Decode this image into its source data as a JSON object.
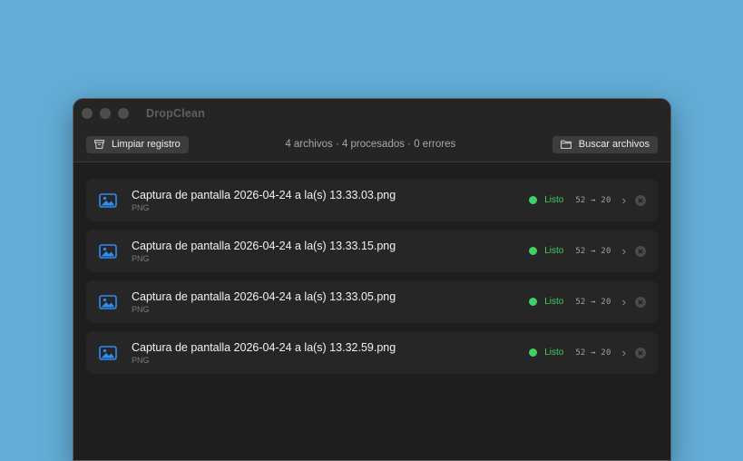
{
  "window": {
    "title": "DropClean"
  },
  "toolbar": {
    "clear_label": "Limpiar registro",
    "summary": "4 archivos · 4 procesados · 0 errores",
    "browse_label": "Buscar archivos"
  },
  "files": [
    {
      "name": "Captura de pantalla 2026-04-24 a la(s) 13.33.03.png",
      "type": "PNG",
      "status": "Listo",
      "size": "52 → 20"
    },
    {
      "name": "Captura de pantalla 2026-04-24 a la(s) 13.33.15.png",
      "type": "PNG",
      "status": "Listo",
      "size": "52 → 20"
    },
    {
      "name": "Captura de pantalla 2026-04-24 a la(s) 13.33.05.png",
      "type": "PNG",
      "status": "Listo",
      "size": "52 → 20"
    },
    {
      "name": "Captura de pantalla 2026-04-24 a la(s) 13.32.59.png",
      "type": "PNG",
      "status": "Listo",
      "size": "52 → 20"
    }
  ],
  "colors": {
    "background": "#62acd6",
    "accent_icon": "#2f8cf0",
    "status_ok": "#3fcf63"
  }
}
